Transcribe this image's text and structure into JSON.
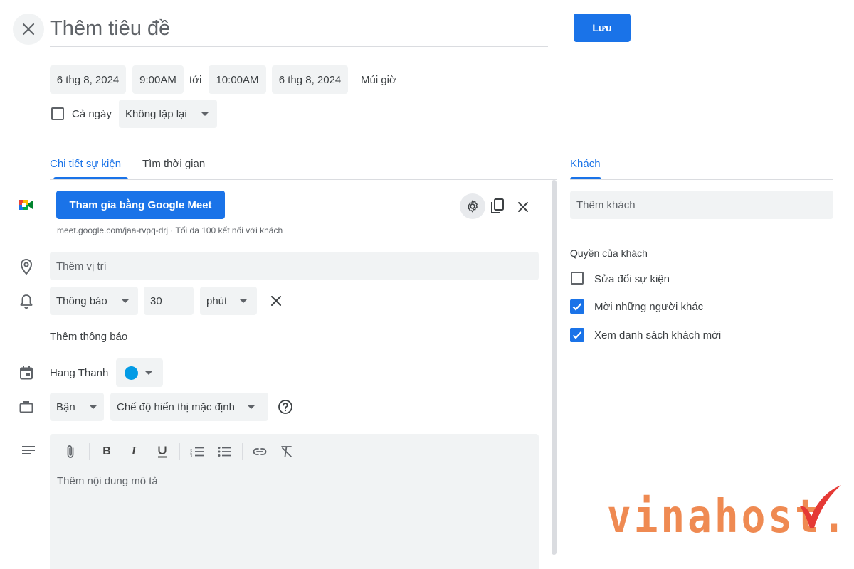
{
  "header": {
    "title_placeholder": "Thêm tiêu đề",
    "save_label": "Lưu"
  },
  "datetime": {
    "start_date": "6 thg 8, 2024",
    "start_time": "9:00AM",
    "to_label": "tới",
    "end_time": "10:00AM",
    "end_date": "6 thg 8, 2024",
    "timezone_label": "Múi giờ",
    "all_day_label": "Cả ngày",
    "all_day_checked": false,
    "repeat_value": "Không lặp lại"
  },
  "tabs": [
    {
      "label": "Chi tiết sự kiện",
      "active": true
    },
    {
      "label": "Tìm thời gian",
      "active": false
    }
  ],
  "meet": {
    "join_label": "Tham gia bằng Google Meet",
    "info": "meet.google.com/jaa-rvpq-drj · Tối đa 100 kết nối với khách"
  },
  "location": {
    "placeholder": "Thêm vị trí"
  },
  "notification": {
    "type": "Thông báo",
    "amount": "30",
    "unit": "phút",
    "add_label": "Thêm thông báo"
  },
  "calendar": {
    "owner": "Hang Thanh",
    "color": "#039be5"
  },
  "availability": {
    "status": "Bận",
    "visibility": "Chế độ hiển thị mặc định"
  },
  "description": {
    "placeholder": "Thêm nội dung mô tả"
  },
  "guests": {
    "tab_label": "Khách",
    "add_placeholder": "Thêm khách",
    "permissions_title": "Quyền của khách",
    "permissions": [
      {
        "label": "Sửa đổi sự kiện",
        "checked": false
      },
      {
        "label": "Mời những người khác",
        "checked": true
      },
      {
        "label": "Xem danh sách khách mời",
        "checked": true
      }
    ]
  },
  "watermark": {
    "text": "vinahost."
  },
  "colors": {
    "accent": "#1a73e8",
    "chip_bg": "#f1f3f4",
    "watermark": "#ef8a52",
    "watermark_check": "#e53935"
  }
}
